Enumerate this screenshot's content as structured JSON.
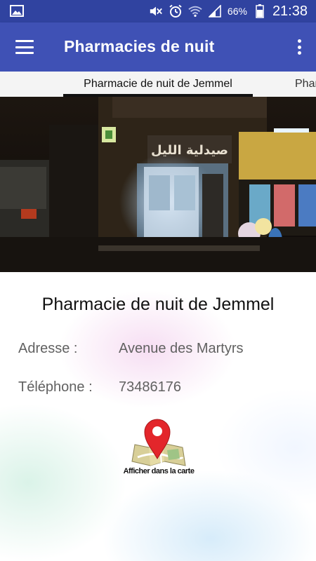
{
  "status_bar": {
    "battery_percent": "66%",
    "time": "21:38",
    "icons": [
      "image-icon",
      "mute-icon",
      "alarm-icon",
      "wifi-icon",
      "signal-icon",
      "battery-icon"
    ]
  },
  "app_bar": {
    "title": "Pharmacies de nuit",
    "icons": [
      "menu-icon",
      "more-vert-icon"
    ]
  },
  "tabs": [
    {
      "label": "Pharmacie de nuit de Jemmel",
      "selected": true
    },
    {
      "label": "Pharmacie de nuit de Ksar Hellal",
      "selected": false
    }
  ],
  "pharmacy": {
    "name": "Pharmacie de nuit de Jemmel",
    "address_label": "Adresse :",
    "address": "Avenue des Martyrs",
    "phone_label": "Téléphone :",
    "phone": "73486176",
    "photo_sign_text": "صيدلية الليل"
  },
  "map_button": {
    "label": "Afficher dans la carte",
    "icon": "map-pin-icon"
  },
  "colors": {
    "status_bar": "#3043a0",
    "app_bar": "#3f51b5",
    "tab_bar": "#f4f4f4",
    "pin_red": "#e3262b"
  }
}
